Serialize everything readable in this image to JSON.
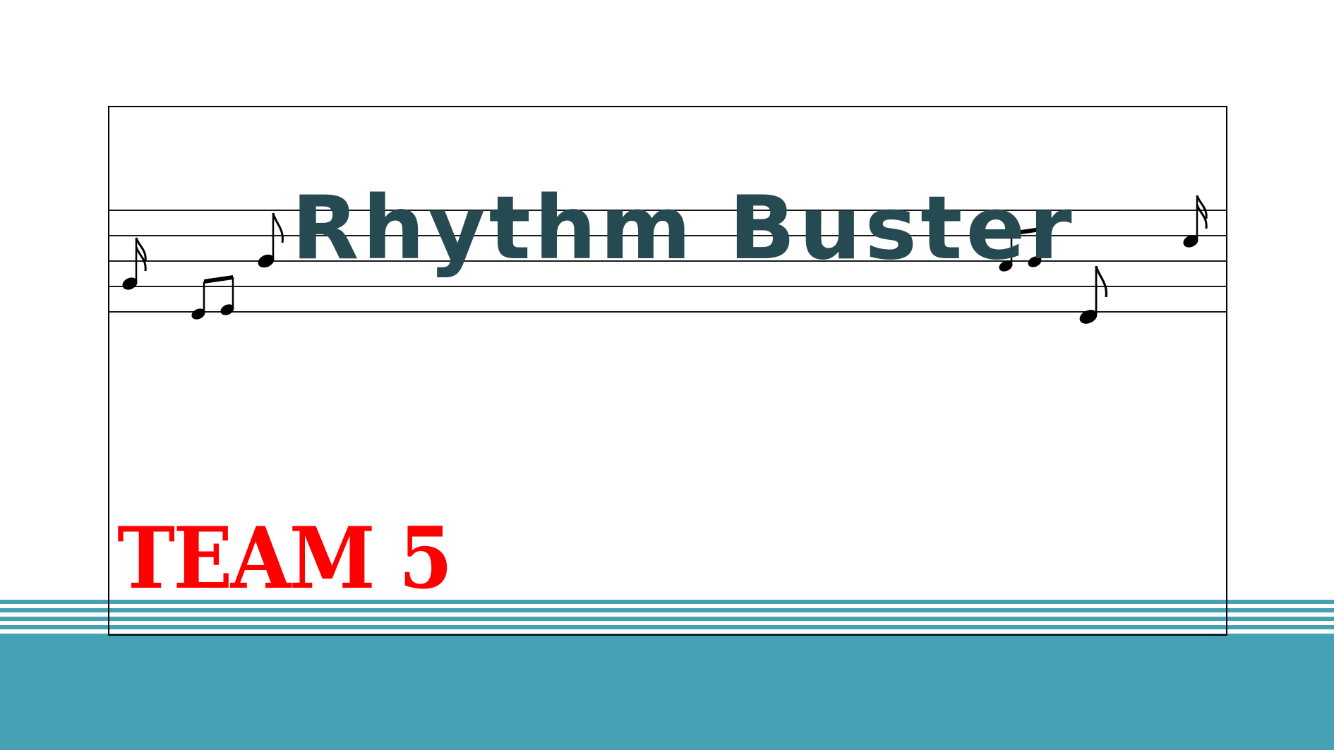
{
  "slide": {
    "title": "Rhythm Buster",
    "subtitle": "TEAM 5"
  },
  "colors": {
    "title": "#264a52",
    "subtitle": "#ff0000",
    "accent_teal": "#46a1b5",
    "frame": "#000000",
    "staff": "#1a1a1a"
  },
  "icons": [
    "sixteenth-note-icon",
    "beamed-eighth-notes-icon",
    "eighth-note-icon",
    "beamed-eighth-notes-icon",
    "eighth-note-icon",
    "sixteenth-note-icon"
  ]
}
